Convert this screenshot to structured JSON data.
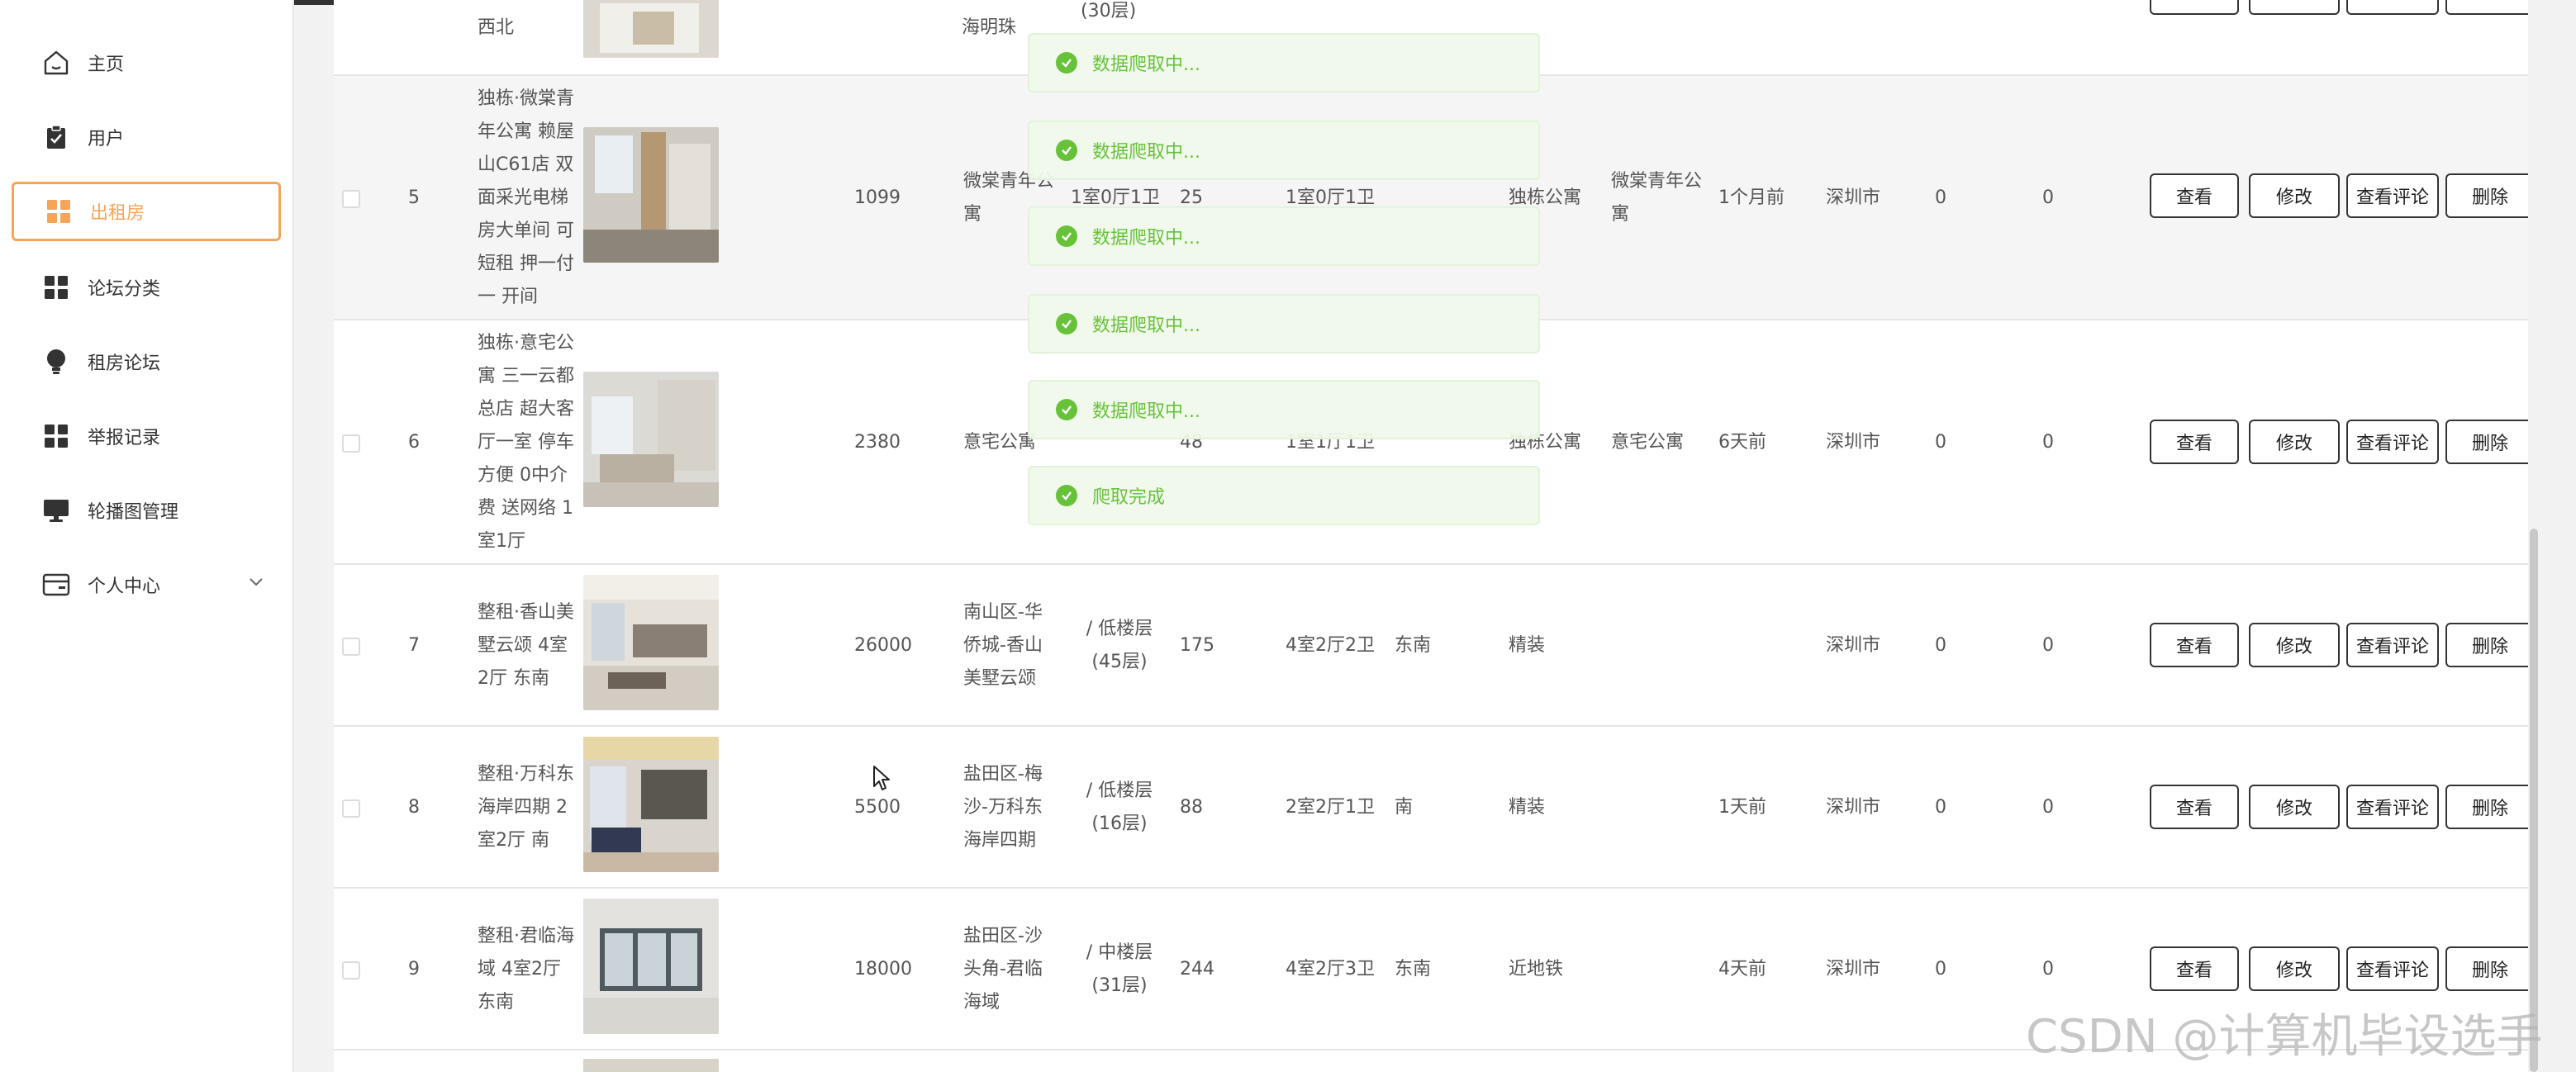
{
  "sidebar": {
    "items": [
      {
        "label": "主页",
        "icon": "home-icon"
      },
      {
        "label": "用户",
        "icon": "clipboard-icon"
      },
      {
        "label": "出租房",
        "icon": "grid-icon"
      },
      {
        "label": "论坛分类",
        "icon": "grid-icon"
      },
      {
        "label": "租房论坛",
        "icon": "bulb-icon"
      },
      {
        "label": "举报记录",
        "icon": "grid-icon"
      },
      {
        "label": "轮播图管理",
        "icon": "monitor-icon"
      },
      {
        "label": "个人中心",
        "icon": "card-icon"
      }
    ],
    "accent_color": "#f5a45a"
  },
  "table": {
    "partial_row": {
      "title": "西北",
      "community": "海明珠",
      "floor": "(30层)"
    },
    "rows": [
      {
        "index": "5",
        "title": [
          "独栋·微棠青",
          "年公寓 赖屋",
          "山C61店 双",
          "面采光电梯",
          "房大单间 可",
          "短租 押一付",
          "一 开间"
        ],
        "price": "1099",
        "community": [
          "微棠青年公",
          "寓"
        ],
        "floor": "",
        "area": "25",
        "layout": "1室0厅1卫",
        "orientation": "",
        "type": "独栋公寓",
        "brand": [
          "微棠青年公",
          "寓"
        ],
        "time": "1个月前",
        "city": "深圳市",
        "n1": "0",
        "n2": "0"
      },
      {
        "index": "6",
        "title": [
          "独栋·意宅公",
          "寓 三一云都",
          "总店 超大客",
          "厅一室 停车",
          "方便 0中介",
          "费 送网络 1",
          "室1厅"
        ],
        "price": "2380",
        "community": [
          "意宅公寓"
        ],
        "floor": "",
        "area": "48",
        "layout": "1室1厅1卫",
        "orientation": "",
        "type": "独栋公寓",
        "brand": [
          "意宅公寓"
        ],
        "time": "6天前",
        "city": "深圳市",
        "n1": "0",
        "n2": "0"
      },
      {
        "index": "7",
        "title": [
          "整租·香山美",
          "墅云颂 4室",
          "2厅 东南"
        ],
        "price": "26000",
        "community": [
          "南山区-华",
          "侨城-香山",
          "美墅云颂"
        ],
        "floor": [
          "/ 低楼层",
          "(45层)"
        ],
        "area": "175",
        "layout": "4室2厅2卫",
        "orientation": "东南",
        "type": "精装",
        "brand": [],
        "time": "",
        "city": "深圳市",
        "n1": "0",
        "n2": "0"
      },
      {
        "index": "8",
        "title": [
          "整租·万科东",
          "海岸四期 2",
          "室2厅 南"
        ],
        "price": "5500",
        "community": [
          "盐田区-梅",
          "沙-万科东",
          "海岸四期"
        ],
        "floor": [
          "/ 低楼层",
          "(16层)"
        ],
        "area": "88",
        "layout": "2室2厅1卫",
        "orientation": "南",
        "type": "精装",
        "brand": [],
        "time": "1天前",
        "city": "深圳市",
        "n1": "0",
        "n2": "0"
      },
      {
        "index": "9",
        "title": [
          "整租·君临海",
          "域 4室2厅",
          "东南"
        ],
        "price": "18000",
        "community": [
          "盐田区-沙",
          "头角-君临",
          "海域"
        ],
        "floor": [
          "/ 中楼层",
          "(31层)"
        ],
        "area": "244",
        "layout": "4室2厅3卫",
        "orientation": "东南",
        "type": "近地铁",
        "brand": [],
        "time": "4天前",
        "city": "深圳市",
        "n1": "0",
        "n2": "0"
      }
    ],
    "actions": {
      "view": "查看",
      "edit": "修改",
      "comments": "查看评论",
      "delete": "删除"
    }
  },
  "toasts": [
    "数据爬取中...",
    "数据爬取中...",
    "数据爬取中...",
    "数据爬取中...",
    "数据爬取中...",
    "爬取完成"
  ],
  "toast_color": "#67c23a",
  "watermark": "CSDN @计算机毕设选手"
}
